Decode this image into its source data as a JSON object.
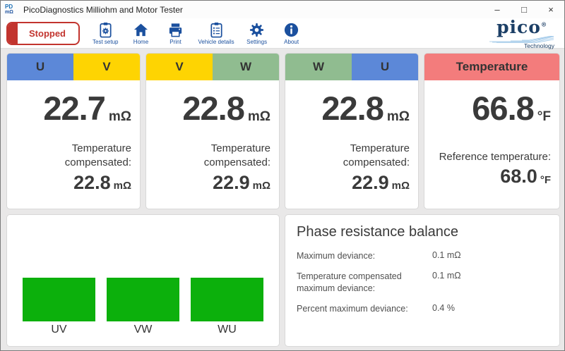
{
  "window": {
    "title": "PicoDiagnostics Milliohm and Motor Tester",
    "app_icon": {
      "top": "PD",
      "bottom": "mΩ"
    },
    "controls": {
      "minimize": "–",
      "maximize": "□",
      "close": "×"
    }
  },
  "toolbar": {
    "status_button": "Stopped",
    "items": [
      {
        "label": "Test setup"
      },
      {
        "label": "Home"
      },
      {
        "label": "Print"
      },
      {
        "label": "Vehicle details"
      },
      {
        "label": "Settings"
      },
      {
        "label": "About"
      }
    ],
    "logo": {
      "brand": "pico",
      "registered": "®",
      "sub": "Technology"
    }
  },
  "cards": [
    {
      "header_left": "U",
      "header_right": "V",
      "value": "22.7",
      "unit": "mΩ",
      "sub_label": "Temperature compensated:",
      "sub_value": "22.8",
      "sub_unit": "mΩ"
    },
    {
      "header_left": "V",
      "header_right": "W",
      "value": "22.8",
      "unit": "mΩ",
      "sub_label": "Temperature compensated:",
      "sub_value": "22.9",
      "sub_unit": "mΩ"
    },
    {
      "header_left": "W",
      "header_right": "U",
      "value": "22.8",
      "unit": "mΩ",
      "sub_label": "Temperature compensated:",
      "sub_value": "22.9",
      "sub_unit": "mΩ"
    },
    {
      "header": "Temperature",
      "value": "66.8",
      "unit": "°F",
      "sub_label": "Reference temperature:",
      "sub_value": "68.0",
      "sub_unit": "°F"
    }
  ],
  "balance_panel": {
    "title": "Phase resistance balance",
    "rows": [
      {
        "label": "Maximum deviance:",
        "value": "0.1 mΩ"
      },
      {
        "label": "Temperature compensated maximum deviance:",
        "value": "0.1 mΩ"
      },
      {
        "label": "Percent maximum deviance:",
        "value": "0.4 %"
      }
    ]
  },
  "chart_data": {
    "type": "bar",
    "categories": [
      "UV",
      "VW",
      "WU"
    ],
    "values": [
      1,
      1,
      1
    ],
    "title": "",
    "xlabel": "",
    "ylabel": "",
    "ylim": [
      0,
      1
    ],
    "bar_color": "#0cb00c"
  },
  "colors": {
    "phase_u_blue": "#5c88d8",
    "phase_v_yellow": "#fed402",
    "phase_w_green": "#90bc90",
    "temperature_red": "#f37c7c",
    "bar_green": "#0cb00c",
    "icon_blue": "#1b509e",
    "stopped_red": "#c2342e"
  }
}
